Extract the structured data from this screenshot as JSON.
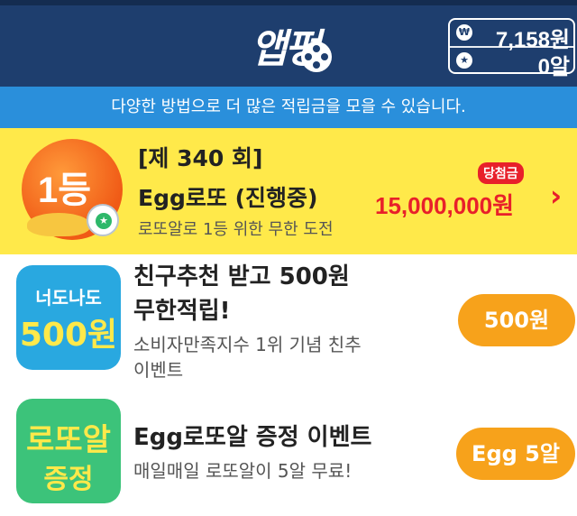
{
  "header": {
    "logo_text": "앱펑",
    "balance": {
      "coin_icon": "coin-icon",
      "coin_symbol": "₩",
      "coin_value": "7,158원",
      "egg_icon": "star-icon",
      "egg_symbol": "★",
      "egg_value": "0알"
    }
  },
  "info_banner": "다양한 방법으로 더 많은 적립금을 모을 수 있습니다.",
  "lotto": {
    "badge_number": "1등",
    "round": "[제 340 회]",
    "title": "Egg로또 (진행중)",
    "subtitle": "로또알로 1등 위한 무한 도전",
    "prize_label": "당첨금",
    "prize_amount": "15,000,000원",
    "arrow": "›"
  },
  "offers": [
    {
      "icon_line1": "너도나도",
      "icon_line2": "500원",
      "icon_color": "#29a8e0",
      "title_line1": "친구추천 받고 500원",
      "title_line2": "무한적립!",
      "desc_line1": "소비자만족지수 1위 기념 친추",
      "desc_line2": "이벤트",
      "reward": "500원"
    },
    {
      "icon_line1": "로또알",
      "icon_line2": "증정",
      "icon_color": "#3cc37a",
      "title_line1": "Egg로또알 증정 이벤트",
      "desc_line1": "매일매일 로또알이 5알 무료!",
      "reward": "Egg 5알"
    }
  ],
  "colors": {
    "header": "#1e3e6e",
    "info_banner": "#2a8fdb",
    "lotto_bg": "#ffe94a",
    "accent_red": "#e8202a",
    "reward_orange": "#f7a21b"
  }
}
